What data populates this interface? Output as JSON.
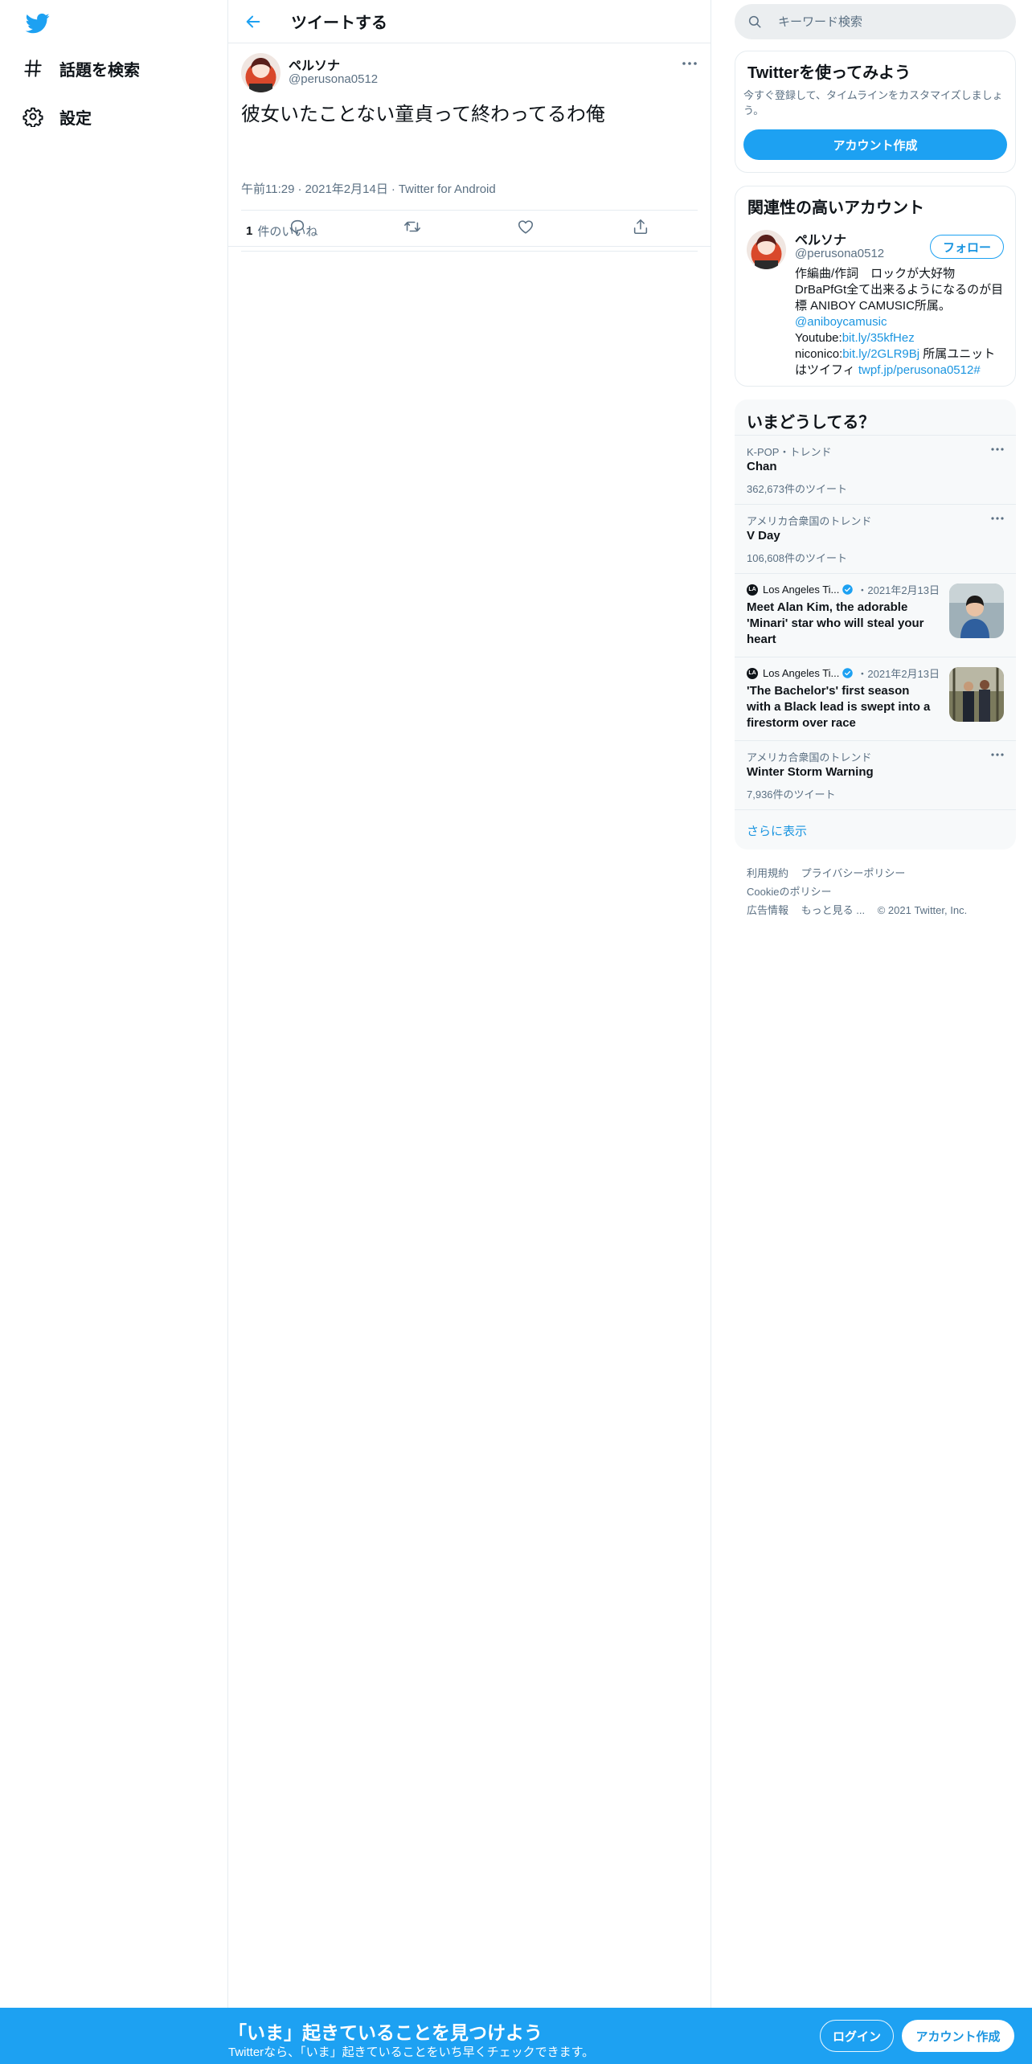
{
  "sidebar": {
    "items": [
      {
        "label": "話題を検索",
        "icon": "hashtag-icon"
      },
      {
        "label": "設定",
        "icon": "gear-icon"
      }
    ]
  },
  "header": {
    "title": "ツイートする"
  },
  "tweet": {
    "name": "ペルソナ",
    "handle": "@perusona0512",
    "text": "彼女いたことない童貞って終わってるわ俺",
    "time": "午前11:29",
    "date": "2021年2月14日",
    "client": "Twitter for Android",
    "likes_count": "1",
    "likes_label": "件のいいね"
  },
  "search": {
    "placeholder": "キーワード検索"
  },
  "signup_card": {
    "title": "Twitterを使ってみよう",
    "subtitle": "今すぐ登録して、タイムラインをカスタマイズしましょう。",
    "button": "アカウント作成"
  },
  "related": {
    "title": "関連性の高いアカウント",
    "name": "ペルソナ",
    "handle": "@perusona0512",
    "follow": "フォロー",
    "bio": {
      "line1": "作編曲/作詞　ロックが大好物",
      "line2": "DrBaPfGt全て出来るようになるのが目",
      "line3": "標 ANIBOY CAMUSIC所属。",
      "mention": "@aniboycamusic",
      "yt_label": "Youtube:",
      "yt_link": "bit.ly/35kfHez",
      "nico_label": "niconico:",
      "nico_link": "bit.ly/2GLR9Bj",
      "nico_rest": " 所属ユニット",
      "last_text": "はツイフィ ",
      "last_link": "twpf.jp/perusona0512#"
    }
  },
  "trends": {
    "title": "いまどうしてる？",
    "items": [
      {
        "meta": "K-POP・トレンド",
        "name": "Chan",
        "count": "362,673件のツイート"
      },
      {
        "meta": "アメリカ合衆国のトレンド",
        "name": "V Day",
        "count": "106,608件のツイート"
      },
      {
        "source": "Los Angeles Ti...",
        "date": "・2021年2月13日",
        "text": "Meet Alan Kim, the adorable 'Minari' star who will steal your heart"
      },
      {
        "source": "Los Angeles Ti...",
        "date": "・2021年2月13日",
        "text": "'The Bachelor's' first season with a Black lead is swept into a firestorm over race"
      },
      {
        "meta": "アメリカ合衆国のトレンド",
        "name": "Winter Storm Warning",
        "count": "7,936件のツイート"
      }
    ],
    "show_more": "さらに表示"
  },
  "footer": {
    "terms": "利用規約",
    "privacy": "プライバシーポリシー",
    "cookie": "Cookieのポリシー",
    "ads": "広告情報",
    "more": "もっと見る ...",
    "copyright": "© 2021 Twitter, Inc."
  },
  "bottom_bar": {
    "title": "「いま」起きていることを見つけよう",
    "subtitle": "Twitterなら、「いま」起きていることをいち早くチェックできます。",
    "login": "ログイン",
    "signup": "アカウント作成"
  },
  "colors": {
    "brand": "#1da1f2",
    "link": "#1b95e0",
    "secondary_text": "#5b7083",
    "border": "#e6ecf0"
  }
}
